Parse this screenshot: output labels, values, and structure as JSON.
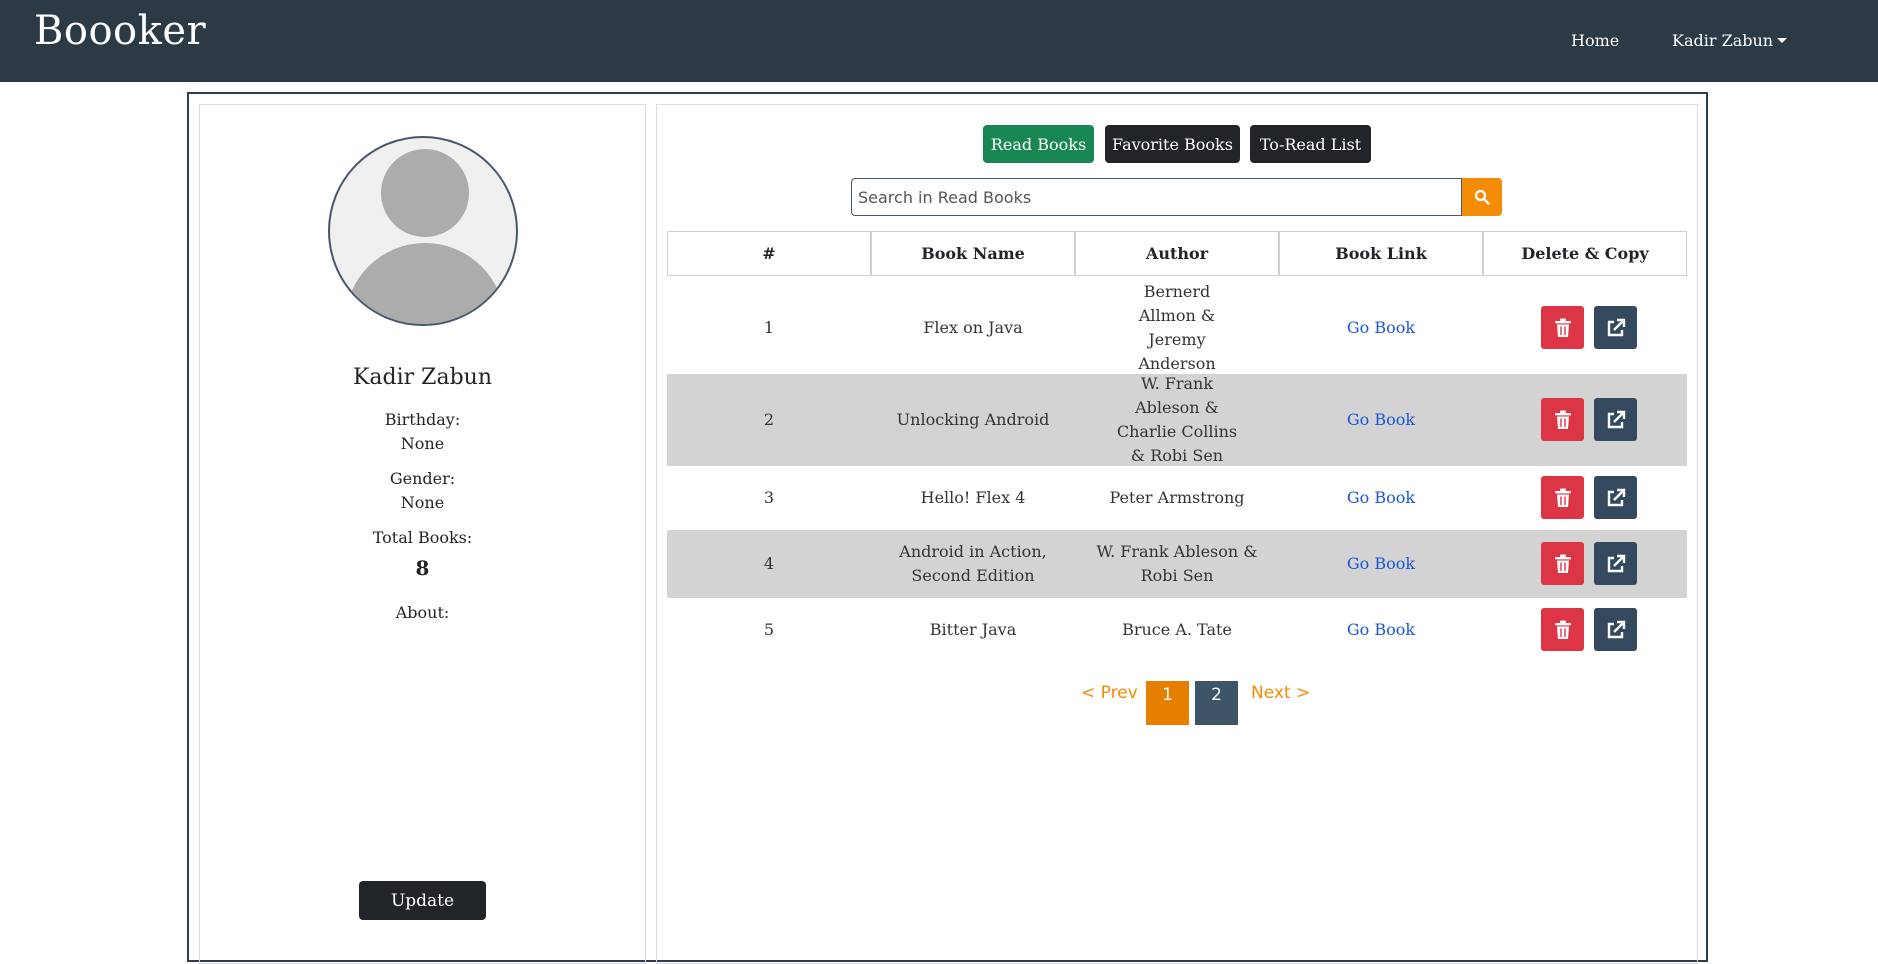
{
  "navbar": {
    "brand": "Boooker",
    "home": "Home",
    "user": "Kadir Zabun"
  },
  "profile": {
    "name": "Kadir Zabun",
    "birthday_label": "Birthday:",
    "birthday_value": "None",
    "gender_label": "Gender:",
    "gender_value": "None",
    "total_label": "Total Books:",
    "total_value": "8",
    "about_label": "About:",
    "update_label": "Update"
  },
  "tabs": {
    "read": "Read Books",
    "favorite": "Favorite Books",
    "toread": "To-Read List"
  },
  "search": {
    "placeholder": "Search in Read Books"
  },
  "table": {
    "headers": [
      "#",
      "Book Name",
      "Author",
      "Book Link",
      "Delete & Copy"
    ],
    "rows": [
      {
        "num": "1",
        "name": "Flex on Java",
        "author": "Bernerd Allmon & Jeremy Anderson",
        "link": "Go Book"
      },
      {
        "num": "2",
        "name": "Unlocking Android",
        "author": "W. Frank Ableson & Charlie Collins & Robi Sen",
        "link": "Go Book"
      },
      {
        "num": "3",
        "name": "Hello! Flex 4",
        "author": "Peter Armstrong",
        "link": "Go Book"
      },
      {
        "num": "4",
        "name": "Android in Action, Second Edition",
        "author": "W. Frank Ableson & Robi Sen",
        "link": "Go Book"
      },
      {
        "num": "5",
        "name": "Bitter Java",
        "author": "Bruce A. Tate",
        "link": "Go Book"
      }
    ]
  },
  "pagination": {
    "prev": "< Prev",
    "pages": [
      "1",
      "2"
    ],
    "current": "1",
    "next": "Next >"
  },
  "colors": {
    "navbar": "#2c3a45",
    "accent": "#f48c06",
    "read_tab": "#198754",
    "delete": "#dc3545",
    "copy": "#34495e"
  },
  "icons": {
    "search": "search-icon",
    "delete": "trash-icon",
    "copy": "external-link-icon"
  }
}
